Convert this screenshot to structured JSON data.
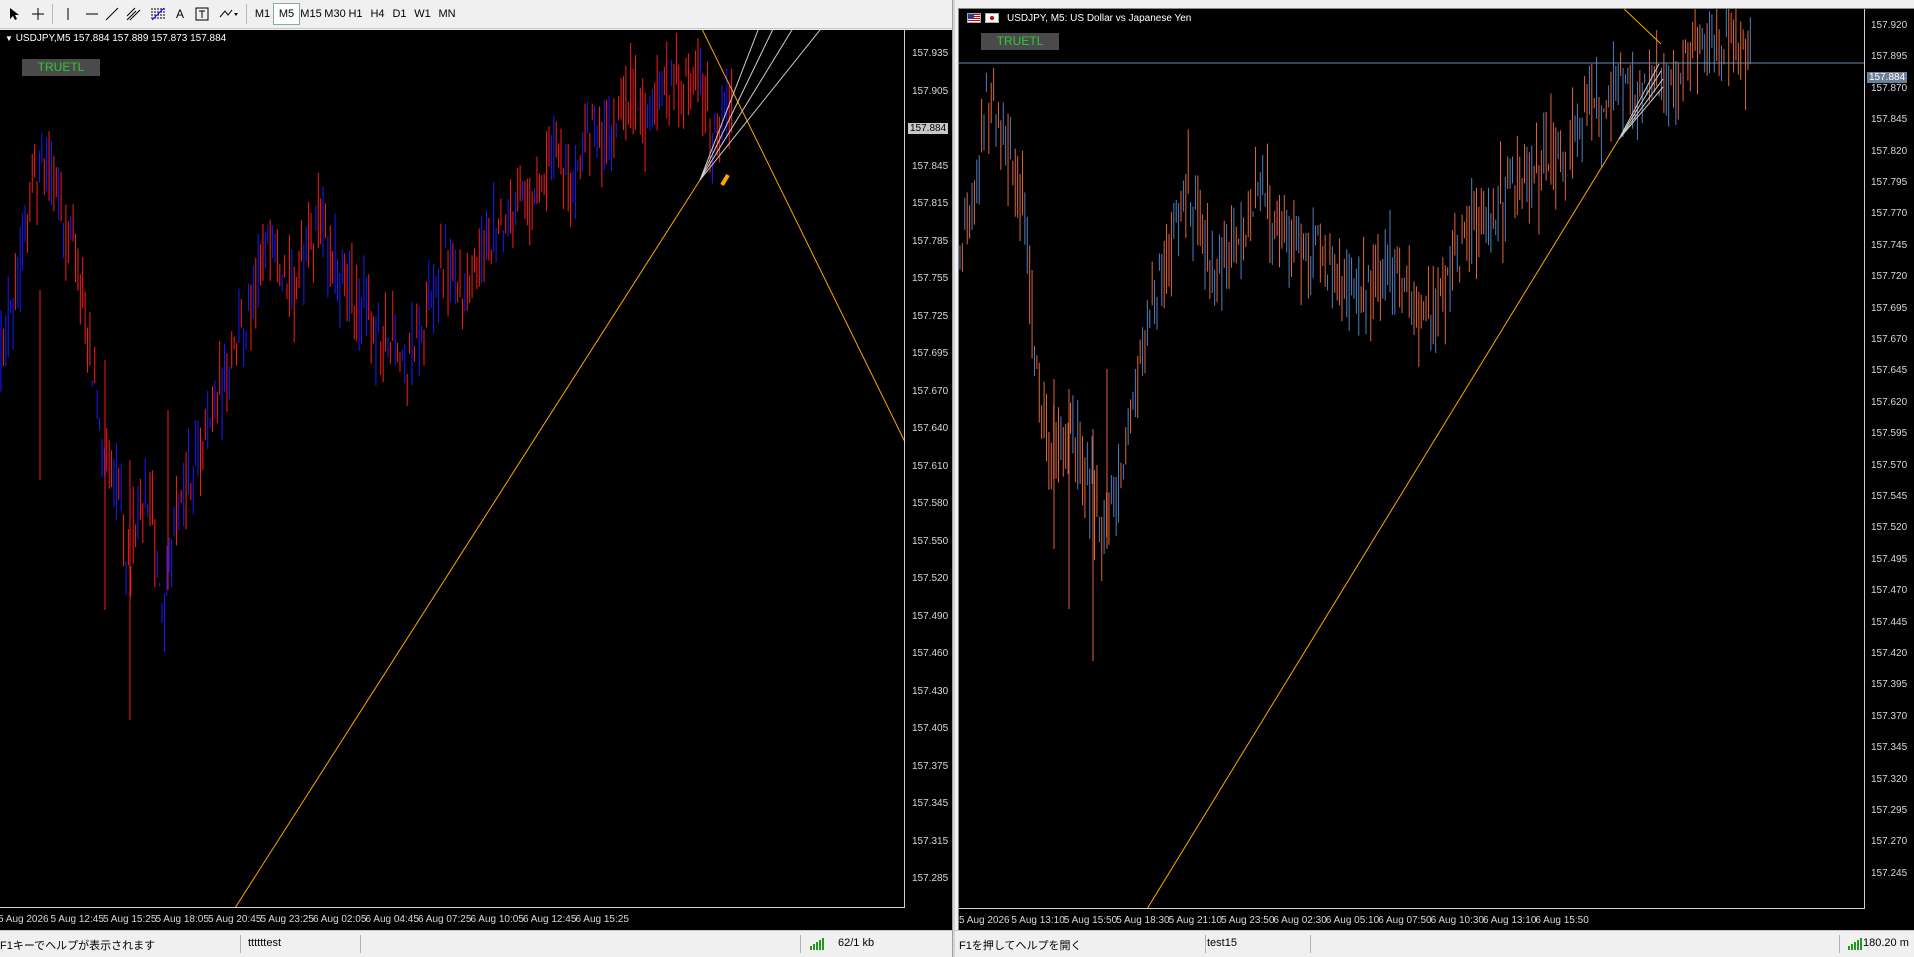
{
  "toolbar": {
    "tools": [
      {
        "icon": "cursor-icon"
      },
      {
        "icon": "crosshair-icon"
      },
      {
        "icon": "vertical-line-icon"
      },
      {
        "icon": "horizontal-line-icon"
      },
      {
        "icon": "trendline-icon"
      },
      {
        "icon": "channel-icon"
      },
      {
        "icon": "fibonacci-icon"
      },
      {
        "icon": "text-icon"
      },
      {
        "icon": "text-label-icon"
      },
      {
        "icon": "arrow-objects-icon"
      }
    ],
    "timeframes": [
      "M1",
      "M5",
      "M15",
      "M30",
      "H1",
      "H4",
      "D1",
      "W1",
      "MN"
    ],
    "active_timeframe": "M5"
  },
  "left_chart": {
    "title": "USDJPY,M5  157.884 157.889 157.873 157.884",
    "button_label": "TRUETL",
    "current_price": "157.884",
    "price_labels": [
      "157.935",
      "157.905",
      "157.875",
      "157.845",
      "157.815",
      "157.785",
      "157.755",
      "157.725",
      "157.695",
      "157.670",
      "157.640",
      "157.610",
      "157.580",
      "157.550",
      "157.520",
      "157.490",
      "157.460",
      "157.430",
      "157.405",
      "157.375",
      "157.345",
      "157.315",
      "157.285"
    ],
    "time_labels": [
      "5 Aug 2026",
      "5 Aug 12:45",
      "5 Aug 15:25",
      "5 Aug 18:05",
      "5 Aug 20:45",
      "5 Aug 23:25",
      "6 Aug 02:05",
      "6 Aug 04:45",
      "6 Aug 07:25",
      "6 Aug 10:05",
      "6 Aug 12:45",
      "6 Aug 15:25"
    ],
    "colors": {
      "background": "#000000",
      "bull": "#1a1aff",
      "bear": "#ff1a1a",
      "line": "#ffa500",
      "fan": "#ffffff"
    }
  },
  "right_chart": {
    "title": "USDJPY, M5:  US Dollar vs Japanese Yen",
    "button_label": "TRUETL",
    "current_price": "157.884",
    "price_labels": [
      "157.920",
      "157.895",
      "157.870",
      "157.845",
      "157.820",
      "157.795",
      "157.770",
      "157.745",
      "157.720",
      "157.695",
      "157.670",
      "157.645",
      "157.620",
      "157.595",
      "157.570",
      "157.545",
      "157.520",
      "157.495",
      "157.470",
      "157.445",
      "157.420",
      "157.395",
      "157.370",
      "157.345",
      "157.320",
      "157.295",
      "157.270",
      "157.245"
    ],
    "time_labels": [
      "5 Aug 2026",
      "5 Aug 13:10",
      "5 Aug 15:50",
      "5 Aug 18:30",
      "5 Aug 21:10",
      "5 Aug 23:50",
      "6 Aug 02:30",
      "6 Aug 05:10",
      "6 Aug 07:50",
      "6 Aug 10:30",
      "6 Aug 13:10",
      "6 Aug 15:50"
    ],
    "colors": {
      "background": "#000000",
      "bull": "#4f7fbf",
      "bear": "#e0643a",
      "line": "#ffa500",
      "hline": "#6b8bb0"
    }
  },
  "left_status": {
    "help": "F1キーでヘルプが表示されます",
    "profile": "ttttttest",
    "traffic": "62/1 kb"
  },
  "right_status": {
    "help": "F1を押してヘルプを開く",
    "profile": "test15",
    "traffic": "180.20 m"
  }
}
